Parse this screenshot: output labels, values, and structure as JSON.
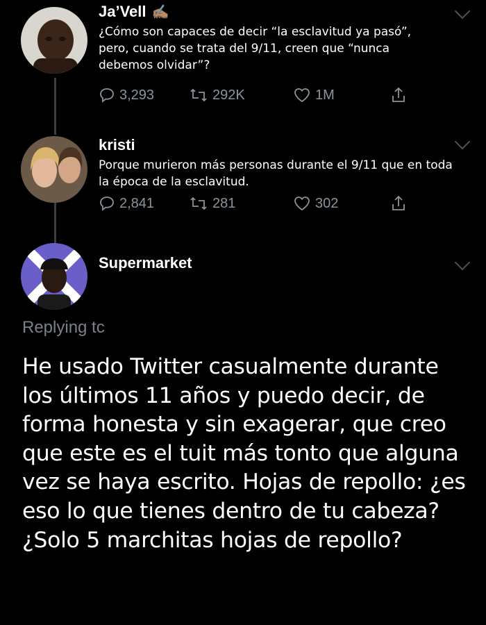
{
  "tweets": [
    {
      "name": "Ja’Vell",
      "text": "¿Cómo son capaces de decir “la esclavitud ya pasó”, pero, cuando se trata del 9/11, creen que “nunca debemos olvidar”?",
      "replies": "3,293",
      "retweets": "292K",
      "likes": "1M"
    },
    {
      "name": "kristi",
      "text": "Porque murieron más personas durante el 9/11 que en toda la época de la esclavitud.",
      "replies": "2,841",
      "retweets": "281",
      "likes": "302"
    },
    {
      "name": "Supermarket"
    }
  ],
  "replying_to": "Replying tc",
  "reply_text": "He usado Twitter casualmente durante los últimos 11 años y puedo decir, de forma honesta y sin exagerar, que creo que este es el tuit más tonto que alguna vez se haya escrito. Hojas de repollo: ¿es eso lo que tienes dentro de tu cabeza? ¿Solo 5 marchitas hojas de repollo?",
  "icons": [
    "reply-icon",
    "retweet-icon",
    "like-icon",
    "share-icon",
    "chevron-down-icon",
    "writing-hand-emoji-icon"
  ],
  "colors": {
    "background": "#000000",
    "text": "#ffffff",
    "muted": "#8b949b",
    "thread_line": "#3a3f44"
  }
}
